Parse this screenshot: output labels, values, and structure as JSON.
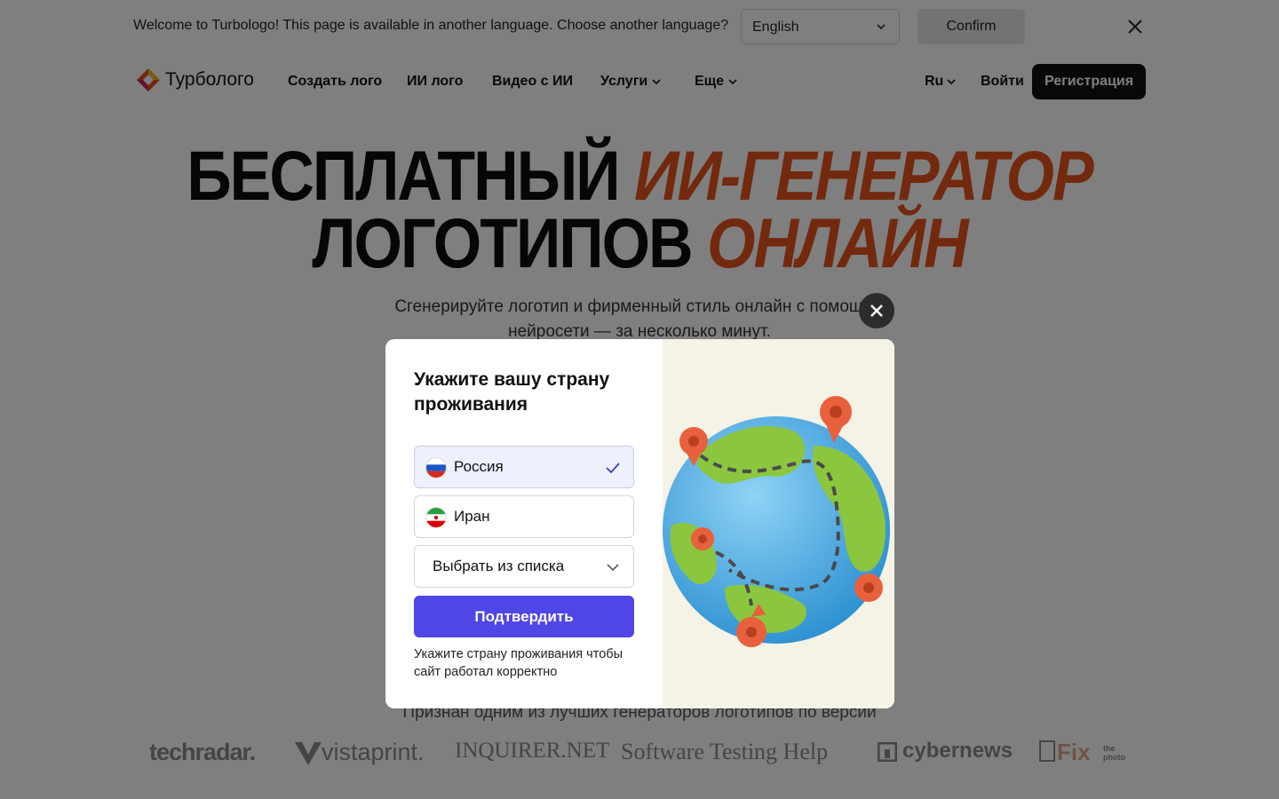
{
  "language_bar": {
    "message": "Welcome to Turbologo! This page is available in another language. Choose another language?",
    "selected_language": "English",
    "confirm_label": "Confirm"
  },
  "header": {
    "logo_text": "Турболого",
    "nav": [
      "Создать лого",
      "ИИ лого",
      "Видео с ИИ",
      "Услуги",
      "Еще"
    ],
    "lang": "Ru",
    "login": "Войти",
    "register": "Регистрация"
  },
  "hero": {
    "line1_dark": "БЕСПЛАТНЫЙ",
    "line1_accent": "ИИ-ГЕНЕРАТОР",
    "line2_dark": "ЛОГОТИПОВ",
    "line2_accent": "ОНЛАЙН",
    "subtitle": "Сгенерируйте логотип и фирменный стиль онлайн с помощью нейросети — за несколько минут.",
    "recognized": "Признан одним из лучших генераторов логотипов по версии",
    "press": [
      "techradar.",
      "vistaprint.",
      "INQUIRER.NET",
      "Software Testing Help",
      "cybernews",
      "Fix the photo"
    ]
  },
  "modal": {
    "title": "Укажите вашу страну проживания",
    "options": [
      {
        "label": "Россия",
        "selected": true
      },
      {
        "label": "Иран",
        "selected": false
      }
    ],
    "select_placeholder": "Выбрать из списка",
    "confirm_label": "Подтвердить",
    "hint": "Укажите страну проживания чтобы сайт работал корректно"
  },
  "colors": {
    "accent": "#e5531c",
    "primary_button": "#4f46e5",
    "dark_button": "#111111",
    "overlay": "rgba(0,0,0,0.5)"
  }
}
